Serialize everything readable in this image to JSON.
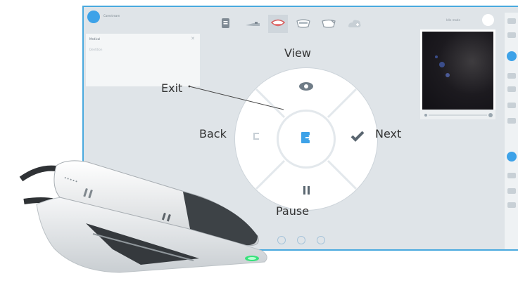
{
  "screen": {
    "user_name": "Carestream",
    "left_panel": {
      "title": "Medical",
      "subtitle": "Dentition",
      "close_icon": "close-icon"
    },
    "top_icons": [
      "document-icon",
      "scanner-tip-icon",
      "mouth-icon",
      "upper-jaw-icon",
      "lower-jaw-icon",
      "cloud-icon"
    ],
    "video_status": "Idle mode",
    "wheel": {
      "view_label": "View",
      "exit_label": "Exit",
      "back_label": "Back",
      "next_label": "Next",
      "pause_label": "Pause",
      "icons": {
        "view": "eye-icon",
        "exit": "exit-icon",
        "back": "back-icon",
        "next": "check-icon",
        "pause": "pause-icon"
      }
    },
    "colors": {
      "accent": "#3da2e8",
      "screen_border": "#49a9de",
      "scanner_led": "#37e27b"
    }
  }
}
